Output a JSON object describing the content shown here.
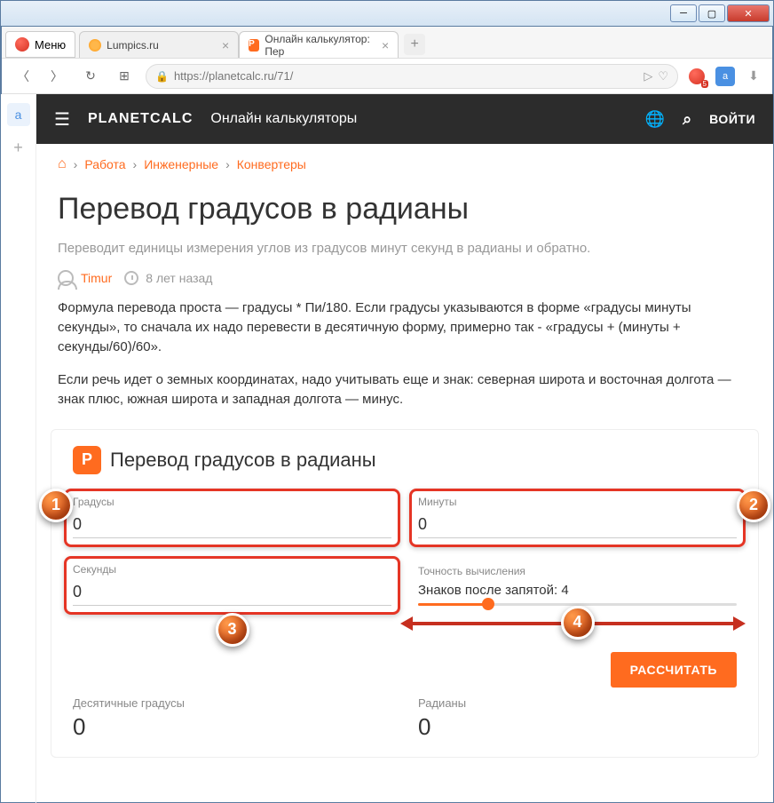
{
  "window": {
    "menu_label": "Меню"
  },
  "tabs": {
    "t0_label": "Lumpics.ru",
    "t1_label": "Онлайн калькулятор: Пер"
  },
  "address": {
    "url": "https://planetcalc.ru/71/",
    "badge": "5"
  },
  "header": {
    "brand": "PLANETCALC",
    "subtitle": "Онлайн калькуляторы",
    "login": "ВОЙТИ"
  },
  "breadcrumb": {
    "b0": "Работа",
    "b1": "Инженерные",
    "b2": "Конвертеры",
    "sep": "›"
  },
  "page": {
    "title": "Перевод градусов в радианы",
    "desc": "Переводит единицы измерения углов из градусов минут секунд в радианы и обратно.",
    "author": "Timur",
    "time": "8 лет назад",
    "body1": "Формула перевода проста — градусы * Пи/180. Если градусы указываются в форме «градусы минуты секунды», то сначала их надо перевести в десятичную форму, примерно так - «градусы + (минуты + секунды/60)/60».",
    "body2": "Если речь идет о земных координатах, надо учитывать еще и знак: северная широта и восточная долгота — знак плюс, южная широта и западная долгота — минус."
  },
  "calc": {
    "title": "Перевод градусов в радианы",
    "logo": "P",
    "degrees_label": "Градусы",
    "degrees_value": "0",
    "minutes_label": "Минуты",
    "minutes_value": "0",
    "seconds_label": "Секунды",
    "seconds_value": "0",
    "precision_label": "Точность вычисления",
    "precision_value": "Знаков после запятой: 4",
    "button": "РАССЧИТАТЬ",
    "result1_label": "Десятичные градусы",
    "result1_value": "0",
    "result2_label": "Радианы",
    "result2_value": "0"
  },
  "annot": {
    "n1": "1",
    "n2": "2",
    "n3": "3",
    "n4": "4"
  }
}
